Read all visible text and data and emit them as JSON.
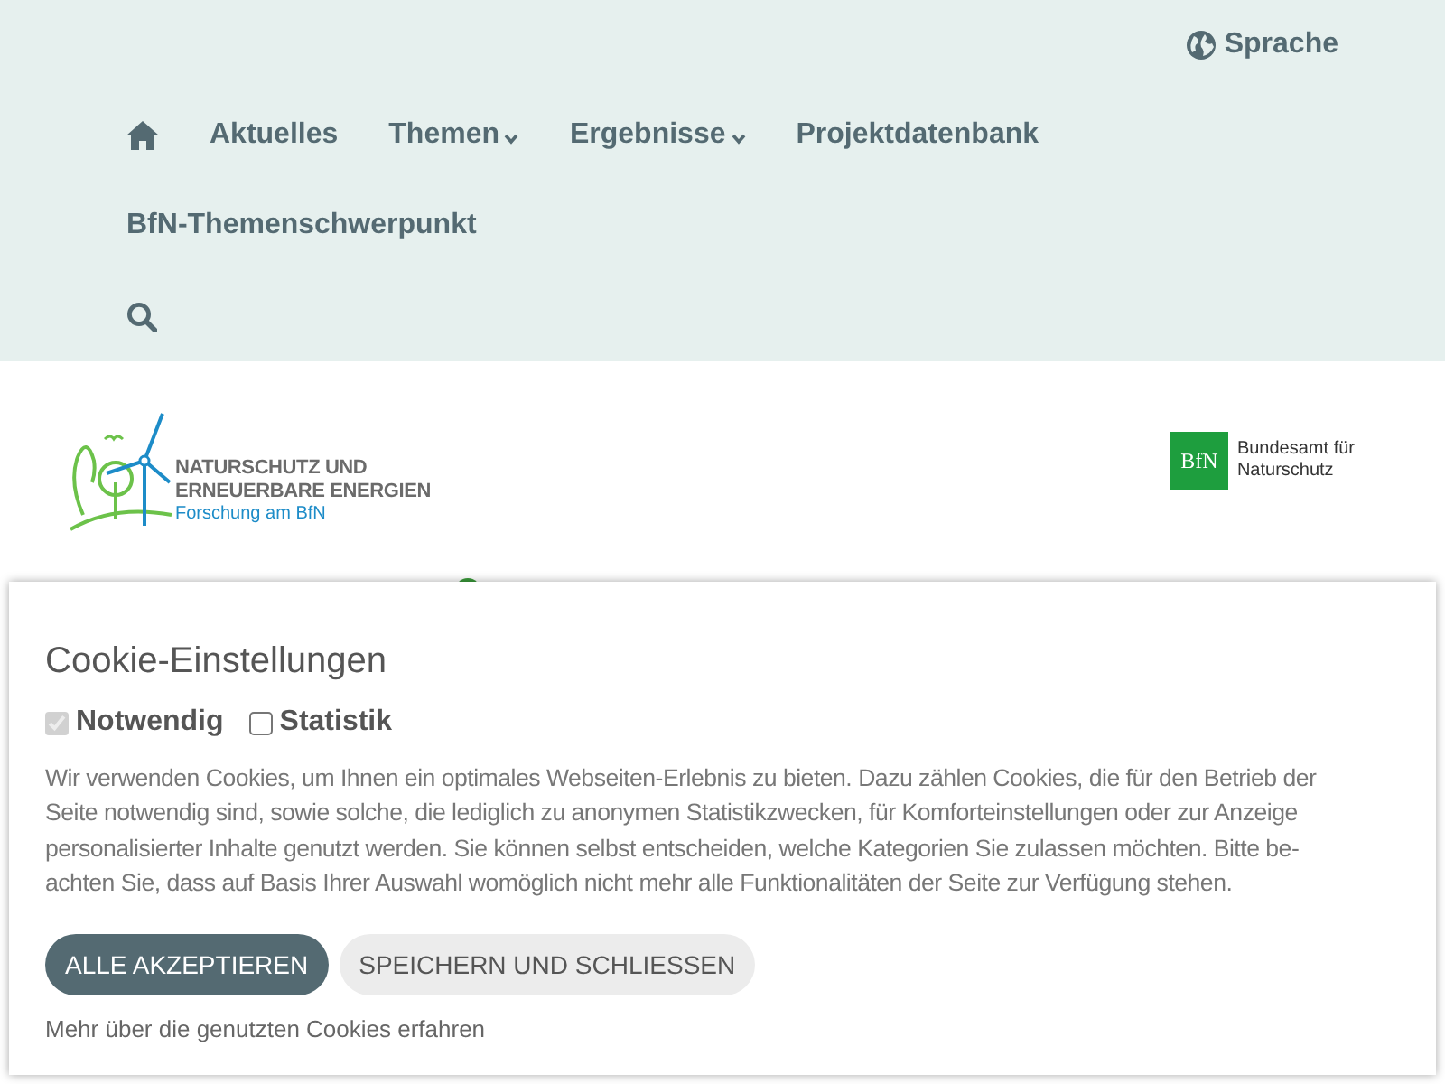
{
  "header": {
    "language": "Sprache",
    "nav": [
      {
        "kind": "home"
      },
      {
        "kind": "link",
        "label": "Aktuelles"
      },
      {
        "kind": "dropdown",
        "label": "Themen"
      },
      {
        "kind": "dropdown",
        "label": "Ergebnisse"
      },
      {
        "kind": "link",
        "label": "Projektdatenbank"
      },
      {
        "kind": "link",
        "label": "BfN-Themenschwerpunkt"
      },
      {
        "kind": "search"
      }
    ]
  },
  "site_logo": {
    "line_1": "NATURSCHUTZ UND",
    "line_2": "ERNEUERBARE ENERGIEN",
    "line_3": "Forschung am BfN"
  },
  "agency_logo": {
    "mark": "BfN",
    "line_1": "Bundesamt für",
    "line_2": "Naturschutz"
  },
  "cookie_dialog": {
    "title": "Cookie-Einstellungen",
    "options": [
      {
        "label": "Notwendig",
        "checked": true,
        "disabled": true
      },
      {
        "label": "Statistik",
        "checked": false,
        "disabled": false
      }
    ],
    "text_lines": [
      "Wir verwenden Cookies, um Ihnen ein optimales Webseiten-Erlebnis zu bieten. Dazu zählen Cookies, die für den Betrieb der",
      "Seite notwendig sind, sowie solche, die lediglich zu anonymen Statistikzwecken, für Komforteinstellungen oder zur Anzeige",
      "personalisierter Inhalte genutzt werden. Sie können selbst entscheiden, welche Kategorien Sie zulassen möchten. Bitte be-",
      "achten Sie, dass auf Basis Ihrer Auswahl womöglich nicht mehr alle Funktionalitäten der Seite zur Verfügung stehen."
    ],
    "buttons": [
      {
        "kind": "primary",
        "label": "ALLE AKZEPTIEREN"
      },
      {
        "kind": "secondary",
        "label": "SPEICHERN UND SCHLIESSEN"
      }
    ],
    "link": "Mehr über die genutzten Cookies erfahren"
  }
}
